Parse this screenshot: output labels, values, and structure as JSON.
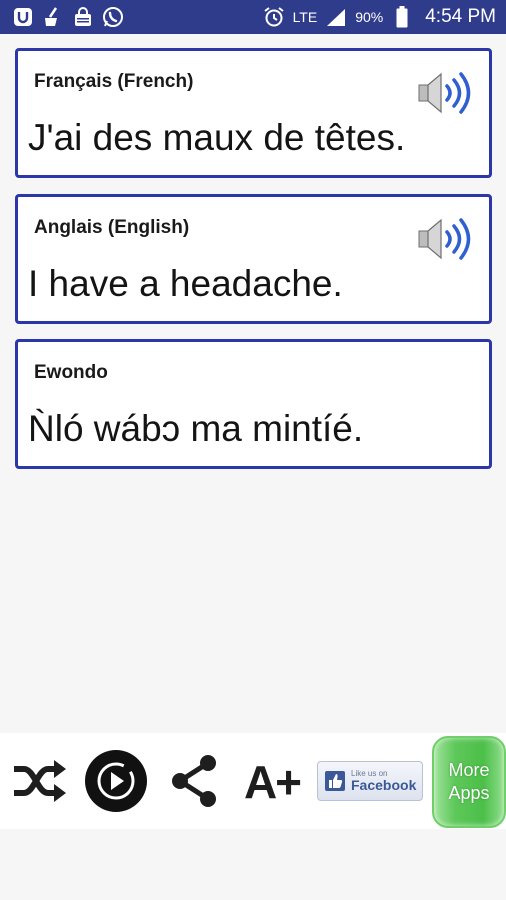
{
  "status_bar": {
    "network": "LTE",
    "battery_percent": "90%",
    "time": "4:54 PM",
    "icons": [
      "u-app-icon",
      "cleaner-icon",
      "bag-icon",
      "whatsapp-icon",
      "alarm-icon",
      "signal-icon",
      "battery-icon"
    ]
  },
  "cards": [
    {
      "label": "Français (French)",
      "text": "J'ai des maux de têtes.",
      "has_speaker": true
    },
    {
      "label": "Anglais (English)",
      "text": "I have a headache.",
      "has_speaker": true
    },
    {
      "label": "Ewondo",
      "text": "Ǹló wábɔ ma mintíé.",
      "has_speaker": false
    }
  ],
  "toolbar": {
    "font_size_label": "A+",
    "facebook_small": "Like us on",
    "facebook_big": "Facebook",
    "more_apps_line1": "More",
    "more_apps_line2": "Apps"
  },
  "colors": {
    "status_bar": "#2f3c8c",
    "card_border": "#2b37a8",
    "speaker_waves": "#2f5fd0",
    "more_apps_green": "#4cbf49"
  }
}
